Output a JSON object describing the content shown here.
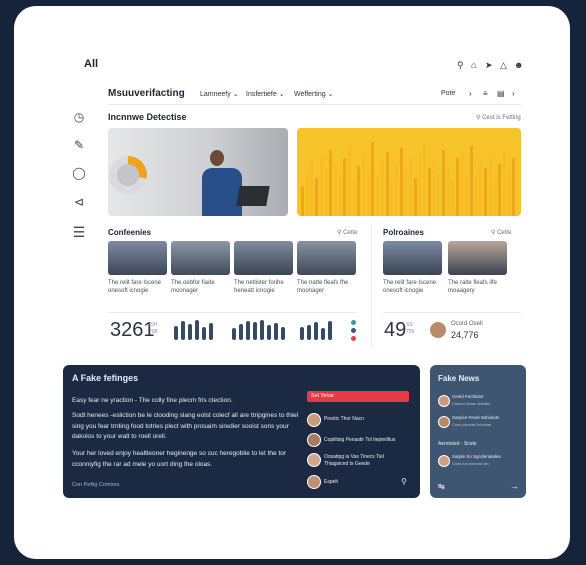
{
  "header": {
    "all_label": "All",
    "icons": [
      "search-icon",
      "home-icon",
      "rocket-icon",
      "bell-icon",
      "user-icon"
    ]
  },
  "toolbar": {
    "title": "Msuuverifacting",
    "dropdowns": [
      "Lamneefy",
      "Insfertiefe",
      "Wefferting"
    ],
    "right_label": "Pote"
  },
  "sidebar": {
    "icons": [
      "clock-icon",
      "pen-icon",
      "shield-icon",
      "share-icon",
      "menu-icon"
    ]
  },
  "section": {
    "title": "Incnnwe Detectise",
    "search_label": "Cest Is Fetting"
  },
  "left_group": {
    "title": "Confeenies",
    "action": "Cette",
    "captions": [
      "The relit fare Iscerie",
      "The oebfor fiade",
      "The netlister forihe",
      "The natte fleafs fhe"
    ],
    "caption_lines2": [
      "onesoft icnogie",
      "moonager",
      "heneatt icnogie",
      "moonager"
    ],
    "stat_value": "3261",
    "stat_sub1": "ISH",
    "stat_sub2": "708"
  },
  "right_group": {
    "title": "Polroaines",
    "action": "Cette",
    "captions": [
      "The relit fare Iscerie",
      "The ralte fleafs ilfe"
    ],
    "caption_lines2": [
      "onesoft icnogie",
      "moaagery"
    ],
    "stat_value": "49",
    "stat_sub1": "SS",
    "stat_sub2": "709",
    "person_name": "Ocord Osell",
    "person_value": "24,776"
  },
  "dark_panel": {
    "title": "A Fake fefinges",
    "lead": "Easy fear ne yraction - The colly fine plecm fris ctection.",
    "para1": "Sodt henees -esliction be le clooding slang eolst colecf all are ttripgines to thiel sing you fear trnting food totries plect with prosaim siredier sooist sons your dakolos to your walt to roell orell.",
    "para2": "Your her loved enjoy healtleoner heginenge so cuc heregoblie to let the tor cconniyfig the rar ad mele yo uort ding the oloas.",
    "footer": "Con Pefiig Comlors",
    "pill": "Sel Yelus",
    "rows": [
      "Prestic Thor Nacn",
      "Copilitsig Penastir Tol Iiepteitlius",
      "Oosatipg ia Vas Tinecs Tiel Thiagsiced ts Geede",
      "Espelt"
    ]
  },
  "news_panel": {
    "title": "Fake News",
    "item1_title": "Ceeld Fechlotor",
    "item1_sub": "Cooiea fichan tebeitie",
    "item2_title": "Sarpice Fecel Sebiolots",
    "item2_sub": "Coss plecetel tchnibar",
    "section_label": "Aereioted - Snste",
    "item3_title": "Sarple So Sgroferiateles",
    "item3_sub": "Cnes fon eclonse tec"
  },
  "colors": {
    "background": "#15243a",
    "accent_yellow": "#f3b515",
    "accent_red": "#e63a46",
    "dark_panel": "#1b2a42",
    "news_panel": "#3f5673"
  }
}
